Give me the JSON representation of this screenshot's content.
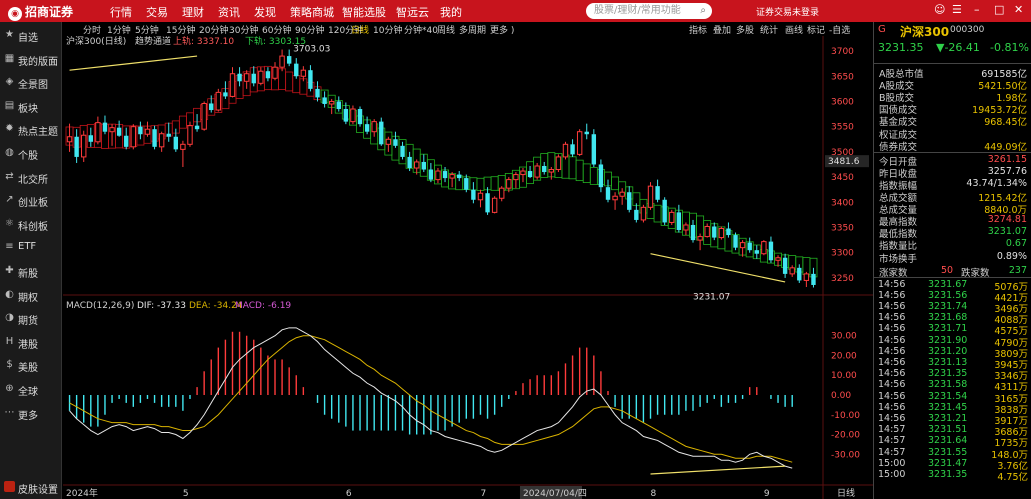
{
  "app": {
    "logo": "招商证券",
    "status": "证券交易未登录"
  },
  "menu": [
    "行情",
    "交易",
    "理财",
    "资讯",
    "发现",
    "策略商城",
    "智能选股",
    "智远云",
    "我的"
  ],
  "search": {
    "placeholder": "股票/理财/常用功能"
  },
  "sidebar": [
    {
      "label": "自选",
      "icon": "star-icon"
    },
    {
      "label": "我的版面",
      "icon": "layout-icon"
    },
    {
      "label": "全景图",
      "icon": "map-icon"
    },
    {
      "label": "板块",
      "icon": "grid-icon"
    },
    {
      "label": "热点主题",
      "icon": "fire-icon"
    },
    {
      "label": "个股",
      "icon": "stock-icon"
    },
    {
      "label": "北交所",
      "icon": "exchange-icon"
    },
    {
      "label": "创业板",
      "icon": "growth-icon"
    },
    {
      "label": "科创板",
      "icon": "tech-icon"
    },
    {
      "label": "ETF",
      "icon": "etf-icon"
    },
    {
      "label": "新股",
      "icon": "new-icon"
    },
    {
      "label": "期权",
      "icon": "option-icon"
    },
    {
      "label": "期货",
      "icon": "futures-icon"
    },
    {
      "label": "港股",
      "icon": "hk-icon"
    },
    {
      "label": "美股",
      "icon": "us-icon"
    },
    {
      "label": "全球",
      "icon": "globe-icon"
    },
    {
      "label": "更多",
      "icon": "more-icon"
    }
  ],
  "skin": "皮肤设置",
  "toolbar": {
    "periods": [
      "分时",
      "1分钟",
      "5分钟",
      "15分钟",
      "20分钟",
      "30分钟",
      "60分钟",
      "90分钟",
      "120分钟",
      "日线",
      "10分钟",
      "分钟*40",
      "周线",
      "多周期",
      "更多 )"
    ],
    "active": "日线",
    "tools": [
      "指标",
      "叠加",
      "多股",
      "统计",
      "画线",
      "标记",
      "-自选"
    ]
  },
  "chart_info": {
    "name": "沪深300(日线)",
    "indicator": "趋势通道",
    "upper": "上轨: 3337.10",
    "lower": "下轨: 3303.15"
  },
  "chart_data": [
    {
      "type": "candlestick",
      "y_ticks": [
        "3700",
        "3650",
        "3600",
        "3550",
        "3500",
        "3450",
        "3400",
        "3350",
        "3300",
        "3250"
      ],
      "ylim": [
        3230,
        3710
      ],
      "x_labels": [
        "2024年",
        "5",
        "6",
        "7",
        "2024/07/04/四",
        "8",
        "9"
      ],
      "annotations": [
        "3703.03",
        "3481.6",
        "3231.07"
      ],
      "ohlc": [
        [
          3520,
          3556,
          3500,
          3530
        ],
        [
          3530,
          3545,
          3478,
          3490
        ],
        [
          3490,
          3542,
          3480,
          3533
        ],
        [
          3533,
          3548,
          3510,
          3520
        ],
        [
          3520,
          3570,
          3515,
          3558
        ],
        [
          3558,
          3572,
          3535,
          3540
        ],
        [
          3540,
          3555,
          3512,
          3548
        ],
        [
          3548,
          3562,
          3530,
          3532
        ],
        [
          3532,
          3548,
          3505,
          3510
        ],
        [
          3510,
          3555,
          3505,
          3550
        ],
        [
          3550,
          3560,
          3525,
          3535
        ],
        [
          3535,
          3560,
          3530,
          3545
        ],
        [
          3545,
          3552,
          3505,
          3510
        ],
        [
          3510,
          3540,
          3500,
          3536
        ],
        [
          3536,
          3558,
          3520,
          3530
        ],
        [
          3530,
          3546,
          3500,
          3505
        ],
        [
          3505,
          3522,
          3470,
          3515
        ],
        [
          3515,
          3560,
          3510,
          3552
        ],
        [
          3552,
          3575,
          3540,
          3545
        ],
        [
          3545,
          3600,
          3542,
          3596
        ],
        [
          3596,
          3612,
          3578,
          3583
        ],
        [
          3583,
          3625,
          3580,
          3618
        ],
        [
          3618,
          3640,
          3605,
          3610
        ],
        [
          3610,
          3668,
          3608,
          3655
        ],
        [
          3655,
          3668,
          3630,
          3640
        ],
        [
          3640,
          3662,
          3625,
          3655
        ],
        [
          3655,
          3670,
          3630,
          3636
        ],
        [
          3636,
          3668,
          3632,
          3660
        ],
        [
          3660,
          3668,
          3640,
          3646
        ],
        [
          3646,
          3678,
          3642,
          3668
        ],
        [
          3668,
          3703,
          3660,
          3690
        ],
        [
          3690,
          3703,
          3670,
          3675
        ],
        [
          3675,
          3686,
          3645,
          3650
        ],
        [
          3650,
          3670,
          3640,
          3662
        ],
        [
          3662,
          3672,
          3620,
          3625
        ],
        [
          3625,
          3640,
          3600,
          3608
        ],
        [
          3608,
          3620,
          3588,
          3595
        ],
        [
          3595,
          3605,
          3575,
          3600
        ],
        [
          3600,
          3610,
          3580,
          3585
        ],
        [
          3585,
          3598,
          3555,
          3560
        ],
        [
          3560,
          3592,
          3555,
          3585
        ],
        [
          3585,
          3590,
          3550,
          3555
        ],
        [
          3555,
          3570,
          3535,
          3540
        ],
        [
          3540,
          3565,
          3530,
          3560
        ],
        [
          3560,
          3568,
          3512,
          3515
        ],
        [
          3515,
          3530,
          3500,
          3525
        ],
        [
          3525,
          3540,
          3508,
          3512
        ],
        [
          3512,
          3520,
          3485,
          3490
        ],
        [
          3490,
          3500,
          3462,
          3468
        ],
        [
          3468,
          3485,
          3455,
          3480
        ],
        [
          3480,
          3495,
          3460,
          3465
        ],
        [
          3465,
          3478,
          3440,
          3445
        ],
        [
          3445,
          3468,
          3438,
          3462
        ],
        [
          3462,
          3470,
          3440,
          3448
        ],
        [
          3448,
          3460,
          3430,
          3455
        ],
        [
          3455,
          3462,
          3442,
          3448
        ],
        [
          3448,
          3455,
          3420,
          3425
        ],
        [
          3425,
          3440,
          3398,
          3405
        ],
        [
          3405,
          3425,
          3390,
          3418
        ],
        [
          3418,
          3430,
          3375,
          3380
        ],
        [
          3380,
          3412,
          3378,
          3408
        ],
        [
          3408,
          3432,
          3402,
          3428
        ],
        [
          3428,
          3450,
          3420,
          3445
        ],
        [
          3445,
          3460,
          3428,
          3455
        ],
        [
          3455,
          3468,
          3440,
          3462
        ],
        [
          3462,
          3472,
          3448,
          3450
        ],
        [
          3450,
          3478,
          3445,
          3472
        ],
        [
          3472,
          3480,
          3455,
          3460
        ],
        [
          3460,
          3470,
          3445,
          3465
        ],
        [
          3465,
          3495,
          3460,
          3490
        ],
        [
          3490,
          3520,
          3485,
          3515
        ],
        [
          3515,
          3525,
          3490,
          3495
        ],
        [
          3495,
          3545,
          3492,
          3540
        ],
        [
          3540,
          3556,
          3525,
          3535
        ],
        [
          3535,
          3545,
          3470,
          3475
        ],
        [
          3475,
          3485,
          3420,
          3430
        ],
        [
          3430,
          3445,
          3400,
          3405
        ],
        [
          3405,
          3420,
          3385,
          3412
        ],
        [
          3412,
          3428,
          3395,
          3420
        ],
        [
          3420,
          3432,
          3380,
          3385
        ],
        [
          3385,
          3398,
          3360,
          3365
        ],
        [
          3365,
          3395,
          3360,
          3390
        ],
        [
          3390,
          3440,
          3385,
          3432
        ],
        [
          3432,
          3445,
          3400,
          3405
        ],
        [
          3405,
          3410,
          3355,
          3360
        ],
        [
          3360,
          3385,
          3355,
          3380
        ],
        [
          3380,
          3395,
          3340,
          3345
        ],
        [
          3345,
          3360,
          3335,
          3355
        ],
        [
          3355,
          3365,
          3320,
          3325
        ],
        [
          3325,
          3338,
          3305,
          3332
        ],
        [
          3332,
          3358,
          3330,
          3352
        ],
        [
          3352,
          3360,
          3325,
          3330
        ],
        [
          3330,
          3352,
          3326,
          3348
        ],
        [
          3348,
          3360,
          3330,
          3335
        ],
        [
          3335,
          3340,
          3305,
          3310
        ],
        [
          3310,
          3325,
          3292,
          3320
        ],
        [
          3320,
          3330,
          3300,
          3305
        ],
        [
          3305,
          3315,
          3288,
          3298
        ],
        [
          3298,
          3325,
          3295,
          3322
        ],
        [
          3322,
          3332,
          3280,
          3285
        ],
        [
          3285,
          3295,
          3272,
          3290
        ],
        [
          3290,
          3298,
          3250,
          3258
        ],
        [
          3258,
          3275,
          3252,
          3270
        ],
        [
          3270,
          3277,
          3240,
          3245
        ],
        [
          3245,
          3262,
          3232,
          3258
        ],
        [
          3258,
          3270,
          3231,
          3236
        ]
      ]
    },
    {
      "type": "line",
      "title": "MACD(12,26,9)",
      "legend": [
        "DIF: -37.33",
        "DEA: -34.24",
        "MACD: -6.19"
      ],
      "y_ticks": [
        "30.00",
        "20.00",
        "10.00",
        "0.00",
        "-10.00",
        "-20.00",
        "-30.00"
      ],
      "ylim": [
        -41,
        41
      ],
      "dif": [
        -8,
        -12,
        -15,
        -18,
        -20,
        -18,
        -16,
        -15,
        -16,
        -18,
        -17,
        -16,
        -17,
        -19,
        -19,
        -20,
        -22,
        -19,
        -15,
        -10,
        -4,
        2,
        8,
        14,
        18,
        21,
        24,
        26,
        28,
        30,
        33,
        34,
        34,
        32,
        30,
        27,
        23,
        20,
        17,
        14,
        11,
        9,
        6,
        4,
        1,
        -1,
        -3,
        -6,
        -10,
        -13,
        -15,
        -18,
        -19,
        -21,
        -22,
        -23,
        -24,
        -25,
        -26,
        -28,
        -29,
        -28,
        -26,
        -24,
        -22,
        -20,
        -18,
        -17,
        -16,
        -14,
        -10,
        -6,
        -1,
        2,
        3,
        0,
        -5,
        -10,
        -14,
        -16,
        -18,
        -21,
        -22,
        -23,
        -25,
        -27,
        -29,
        -30,
        -31,
        -31,
        -31,
        -31,
        -33,
        -33,
        -34,
        -33,
        -30,
        -29,
        -31,
        -32,
        -34,
        -36,
        -37
      ],
      "dea": [
        -4,
        -6,
        -8,
        -10,
        -12,
        -13,
        -14,
        -14,
        -14,
        -15,
        -15,
        -15,
        -15,
        -16,
        -16,
        -17,
        -18,
        -18,
        -17,
        -16,
        -13,
        -10,
        -6,
        -2,
        2,
        6,
        10,
        14,
        18,
        21,
        24,
        27,
        29,
        30,
        30,
        29,
        28,
        26,
        24,
        22,
        20,
        18,
        15,
        13,
        10,
        8,
        6,
        3,
        0,
        -3,
        -5,
        -8,
        -10,
        -12,
        -14,
        -16,
        -18,
        -19,
        -21,
        -22,
        -24,
        -25,
        -25,
        -25,
        -25,
        -24,
        -23,
        -22,
        -21,
        -20,
        -18,
        -16,
        -13,
        -10,
        -7,
        -6,
        -6,
        -7,
        -8,
        -10,
        -12,
        -14,
        -16,
        -18,
        -20,
        -22,
        -24,
        -26,
        -27,
        -28,
        -29,
        -30,
        -30,
        -31,
        -32,
        -32,
        -32,
        -31,
        -31,
        -31,
        -32,
        -33,
        -34
      ],
      "macd": [
        -8,
        -12,
        -14,
        -16,
        -16,
        -10,
        -4,
        -2,
        -4,
        -6,
        -4,
        -2,
        -4,
        -6,
        -6,
        -6,
        -8,
        -2,
        4,
        12,
        18,
        24,
        28,
        32,
        32,
        30,
        28,
        24,
        20,
        18,
        18,
        14,
        10,
        4,
        0,
        -4,
        -10,
        -12,
        -14,
        -16,
        -18,
        -18,
        -18,
        -18,
        -18,
        -18,
        -18,
        -18,
        -20,
        -20,
        -20,
        -20,
        -18,
        -18,
        -16,
        -14,
        -12,
        -12,
        -10,
        -12,
        -10,
        -6,
        -2,
        2,
        6,
        8,
        10,
        10,
        10,
        12,
        16,
        20,
        24,
        24,
        20,
        12,
        2,
        -6,
        -12,
        -12,
        -12,
        -14,
        -12,
        -10,
        -10,
        -10,
        -10,
        -8,
        -8,
        -6,
        -4,
        -2,
        -6,
        -4,
        -4,
        -2,
        4,
        4,
        0,
        -2,
        -4,
        -6,
        -6
      ]
    }
  ],
  "right_panel": {
    "header": {
      "code_label": "G",
      "name": "沪深300",
      "code": "000300",
      "price": "3231.35",
      "change": "-26.41",
      "pct": "-0.81%"
    },
    "stats": [
      {
        "label": "A股总市值",
        "value": "691585亿",
        "color": "#e0e0e0"
      },
      {
        "label": "A股成交",
        "value": "5421.50亿",
        "color": "#e8c200"
      },
      {
        "label": "B股成交",
        "value": "1.98亿",
        "color": "#e8c200"
      },
      {
        "label": "国债成交",
        "value": "19453.72亿",
        "color": "#e8c200"
      },
      {
        "label": "基金成交",
        "value": "968.45亿",
        "color": "#e8c200"
      },
      {
        "label": "权证成交",
        "value": "",
        "color": "#e8c200"
      },
      {
        "label": "债券成交",
        "value": "449.09亿",
        "color": "#e8c200"
      }
    ],
    "quotes": [
      {
        "label": "今日开盘",
        "value": "3261.15",
        "color": "#ff4d4d"
      },
      {
        "label": "昨日收盘",
        "value": "3257.76",
        "color": "#e0e0e0"
      },
      {
        "label": "指数振幅",
        "value": "43.74/1.34%",
        "color": "#e0e0e0"
      },
      {
        "label": "总成交额",
        "value": "1215.42亿",
        "color": "#e8c200"
      },
      {
        "label": "总成交量",
        "value": "8840.0万",
        "color": "#e8c200"
      },
      {
        "label": "最高指数",
        "value": "3274.81",
        "color": "#ff4d4d"
      },
      {
        "label": "最低指数",
        "value": "3231.07",
        "color": "#2fd24a"
      },
      {
        "label": "指数量比",
        "value": "0.67",
        "color": "#2fd24a"
      },
      {
        "label": "市场换手",
        "value": "0.89%",
        "color": "#e0e0e0"
      }
    ],
    "updown": {
      "up_label": "涨家数",
      "up": "50",
      "down_label": "跌家数",
      "down": "237"
    },
    "ticks": [
      [
        "14:56",
        "3231.67",
        "5076万"
      ],
      [
        "14:56",
        "3231.56",
        "4421万"
      ],
      [
        "14:56",
        "3231.74",
        "3496万"
      ],
      [
        "14:56",
        "3231.68",
        "4088万"
      ],
      [
        "14:56",
        "3231.71",
        "4575万"
      ],
      [
        "14:56",
        "3231.90",
        "4790万"
      ],
      [
        "14:56",
        "3231.20",
        "3809万"
      ],
      [
        "14:56",
        "3231.13",
        "3945万"
      ],
      [
        "14:56",
        "3231.35",
        "3346万"
      ],
      [
        "14:56",
        "3231.58",
        "4311万"
      ],
      [
        "14:56",
        "3231.54",
        "3165万"
      ],
      [
        "14:56",
        "3231.45",
        "3838万"
      ],
      [
        "14:56",
        "3231.21",
        "3917万"
      ],
      [
        "14:57",
        "3231.51",
        "3686万"
      ],
      [
        "14:57",
        "3231.64",
        "1735万"
      ],
      [
        "14:57",
        "3231.55",
        "148.0万"
      ],
      [
        "15:00",
        "3231.47",
        "3.76亿"
      ],
      [
        "15:00",
        "3231.35",
        "4.75亿"
      ]
    ]
  },
  "colors": {
    "up": "#ff3b3b",
    "down": "#41e7f0",
    "dif": "#e6e6e6",
    "dea": "#d9b300",
    "channel_up": "#c2141a",
    "channel_down": "#22b021",
    "trend": "#f0e06a"
  }
}
